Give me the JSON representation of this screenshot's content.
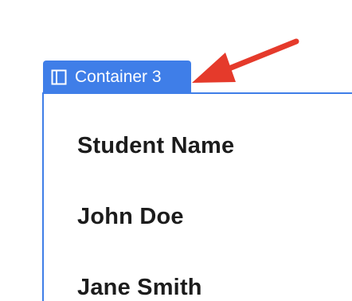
{
  "container": {
    "label": "Container 3",
    "accent_color": "#3f7ee8",
    "icon": "columns-icon"
  },
  "rows": [
    {
      "text": "Student Name"
    },
    {
      "text": "John Doe"
    },
    {
      "text": "Jane Smith"
    }
  ],
  "annotation": {
    "icon": "arrow-pointer-icon",
    "color": "#e53a2b"
  }
}
